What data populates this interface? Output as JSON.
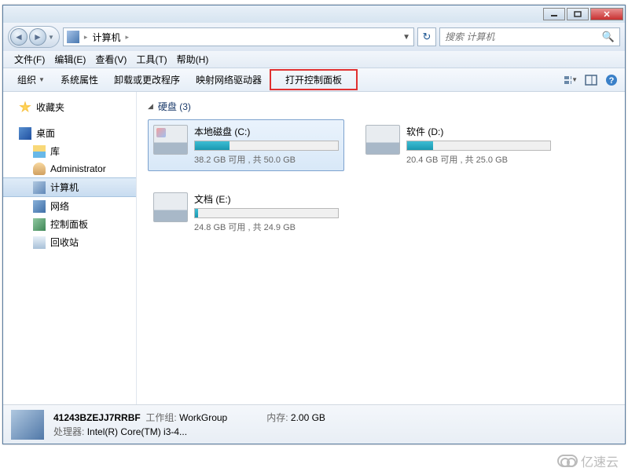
{
  "address": {
    "location": "计算机"
  },
  "search": {
    "placeholder": "搜索 计算机"
  },
  "menu": {
    "file": "文件(F)",
    "edit": "编辑(E)",
    "view": "查看(V)",
    "tools": "工具(T)",
    "help": "帮助(H)"
  },
  "toolbar": {
    "organize": "组织",
    "properties": "系统属性",
    "uninstall": "卸载或更改程序",
    "map_drive": "映射网络驱动器",
    "control_panel": "打开控制面板"
  },
  "sidebar": {
    "favorites": "收藏夹",
    "desktop": "桌面",
    "libraries": "库",
    "admin": "Administrator",
    "computer": "计算机",
    "network": "网络",
    "control": "控制面板",
    "recycle": "回收站"
  },
  "section": {
    "title": "硬盘 (3)"
  },
  "drives": [
    {
      "name": "本地磁盘 (C:)",
      "stats": "38.2 GB 可用 , 共 50.0 GB",
      "fill": 24
    },
    {
      "name": "软件 (D:)",
      "stats": "20.4 GB 可用 , 共 25.0 GB",
      "fill": 18
    },
    {
      "name": "文档 (E:)",
      "stats": "24.8 GB 可用 , 共 24.9 GB",
      "fill": 2
    }
  ],
  "status": {
    "name": "41243BZEJJ7RRBF",
    "workgroup_label": "工作组:",
    "workgroup": "WorkGroup",
    "memory_label": "内存:",
    "memory": "2.00 GB",
    "cpu_label": "处理器:",
    "cpu": "Intel(R) Core(TM) i3-4..."
  },
  "watermark": "亿速云"
}
